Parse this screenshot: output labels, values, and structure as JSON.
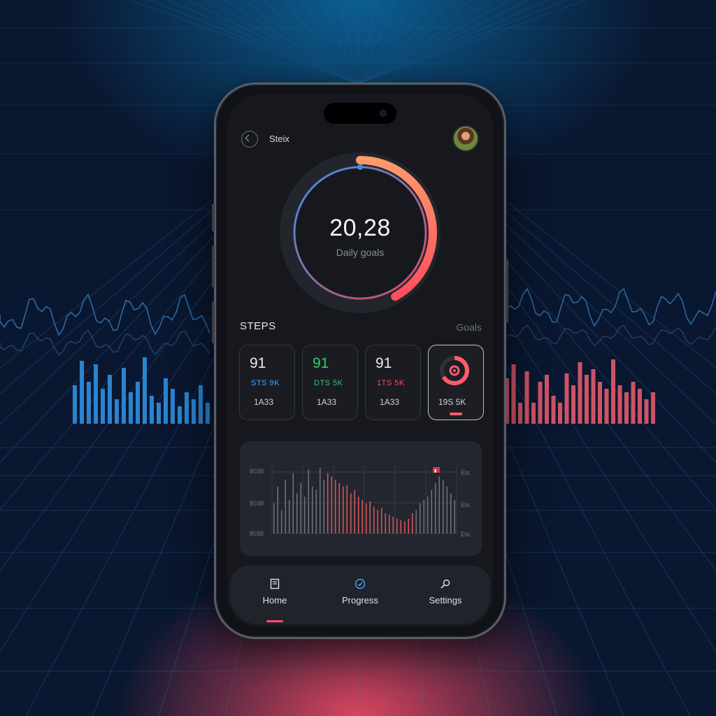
{
  "app": {
    "title": "Steix",
    "avatar_name": "avatar"
  },
  "ring": {
    "value": "20,28",
    "label": "Daily goals",
    "progress": 0.42,
    "colors": {
      "blue": "#3b8fe0",
      "red": "#ff4d5e",
      "orange": "#ff9a6b"
    }
  },
  "section": {
    "title": "STEPS",
    "link": "Goals"
  },
  "cards": [
    {
      "big": "91",
      "mid": "STS 9K",
      "sub": "1A33",
      "color": "#4aa3ff"
    },
    {
      "big": "91",
      "mid": "DTS 5K",
      "sub": "1A33",
      "color": "#39c86a"
    },
    {
      "big": "91",
      "mid": "1TS 5K",
      "sub": "1A33",
      "color": "#ff4d5e"
    },
    {
      "sub": "19S 5K",
      "icon": "goal-ring-icon",
      "color": "#ff5b6b"
    }
  ],
  "chart": {
    "y_ticks_left": [
      "8038",
      "8038",
      "8038"
    ],
    "y_ticks_right": [
      "Ets",
      "Ets",
      "Ets"
    ],
    "flag": "▮"
  },
  "nav": {
    "items": [
      {
        "label": "Home",
        "icon": "home-icon",
        "active": true
      },
      {
        "label": "Progress",
        "icon": "progress-icon",
        "active": false
      },
      {
        "label": "Settings",
        "icon": "settings-icon",
        "active": false
      }
    ]
  },
  "chart_data": {
    "type": "bar",
    "values": [
      0.45,
      0.7,
      0.35,
      0.8,
      0.5,
      0.9,
      0.6,
      0.75,
      0.55,
      0.95,
      0.7,
      0.65,
      0.98,
      0.8,
      0.9,
      0.85,
      0.8,
      0.75,
      0.7,
      0.72,
      0.6,
      0.65,
      0.55,
      0.5,
      0.45,
      0.48,
      0.4,
      0.35,
      0.38,
      0.3,
      0.28,
      0.25,
      0.22,
      0.2,
      0.18,
      0.22,
      0.3,
      0.35,
      0.45,
      0.5,
      0.55,
      0.65,
      0.75,
      0.85,
      0.8,
      0.7,
      0.6,
      0.5
    ],
    "highlight_range": [
      14,
      36
    ]
  }
}
